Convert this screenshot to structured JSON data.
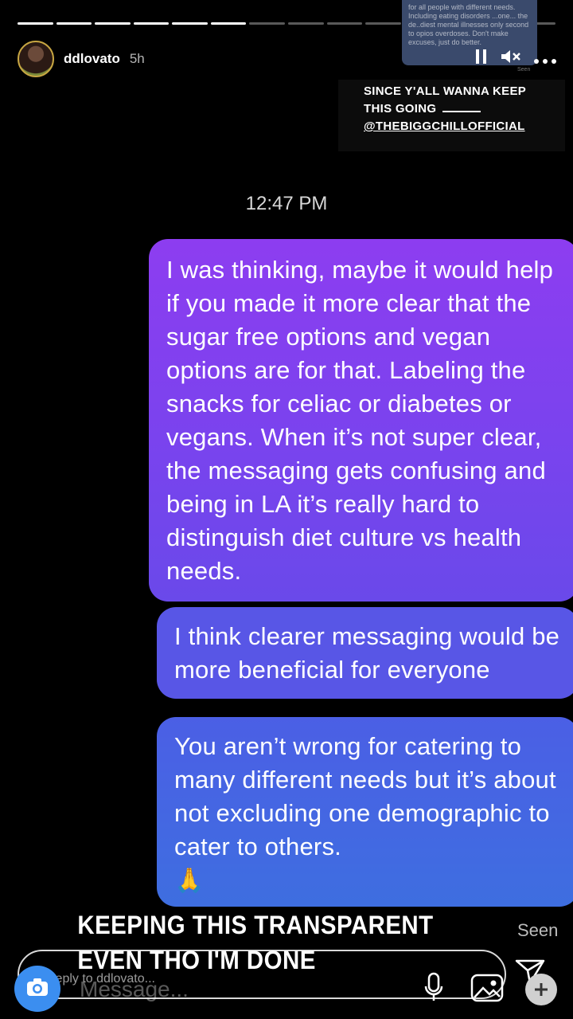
{
  "story": {
    "username": "ddlovato",
    "age": "5h",
    "progress_segments": 14,
    "progress_done": 6
  },
  "inset_screenshot": {
    "text": "for all people with different needs. Including eating disorders ...one... the de..diest mental illnesses only second to opios overdoses. Don't make excuses, just do better.",
    "seen": "Seen"
  },
  "caption": {
    "line1": "SINCE Y'ALL WANNA KEEP",
    "line2": "THIS GOING",
    "line3": "@THEBIGGCHILLOFFICIAL"
  },
  "chat": {
    "timestamp": "12:47 PM",
    "messages": [
      "I was thinking, maybe it would help if you made it more clear that the sugar free options and vegan options are for that. Labeling the snacks for celiac or diabetes or vegans. When it’s not super clear, the messaging gets confusing and being in LA it’s really hard to distinguish diet culture vs health needs.",
      "I think clearer messaging would be more beneficial for everyone",
      "You aren’t wrong for catering to many different needs but it’s about not excluding one demographic to cater to others."
    ],
    "emoji": "🙏",
    "seen": "Seen"
  },
  "overlay": {
    "line1": "KEEPING THIS TRANSPARENT",
    "line2": "EVEN THO I'M DONE"
  },
  "reply": {
    "placeholder": "Reply to ddlovato...",
    "message_placeholder": "Message..."
  },
  "colors": {
    "bubble_top": "#8d3df0",
    "bubble_mid": "#5856e6",
    "bubble_bottom": "#3e6ee0",
    "camera": "#3b8ef0"
  }
}
